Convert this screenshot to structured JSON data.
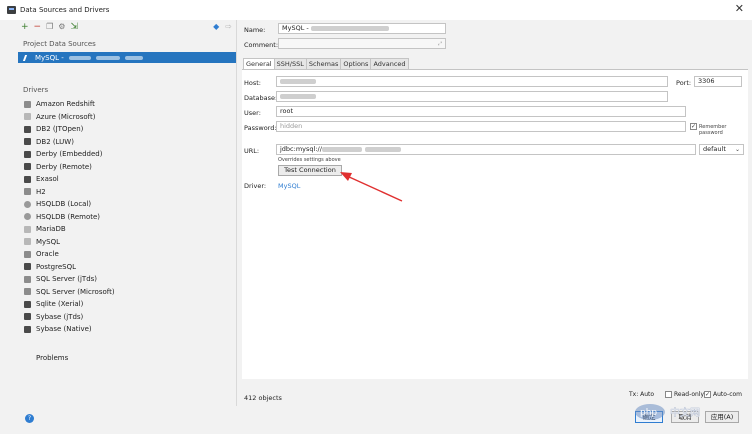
{
  "window": {
    "title": "Data Sources and Drivers",
    "close_glyph": "✕"
  },
  "left": {
    "project_label": "Project Data Sources",
    "selected_source": "MySQL - ",
    "drivers_label": "Drivers",
    "drivers": [
      "Amazon Redshift",
      "Azure (Microsoft)",
      "DB2 (JTOpen)",
      "DB2 (LUW)",
      "Derby (Embedded)",
      "Derby (Remote)",
      "Exasol",
      "H2",
      "HSQLDB (Local)",
      "HSQLDB (Remote)",
      "MariaDB",
      "MySQL",
      "Oracle",
      "PostgreSQL",
      "SQL Server (jTds)",
      "SQL Server (Microsoft)",
      "Sqlite (Xerial)",
      "Sybase (jTds)",
      "Sybase (Native)"
    ],
    "problems_label": "Problems"
  },
  "form": {
    "name_label": "Name:",
    "name_value": "MySQL - ",
    "comment_label": "Comment:",
    "tabs": [
      "General",
      "SSH/SSL",
      "Schemas",
      "Options",
      "Advanced"
    ],
    "host_label": "Host:",
    "port_label": "Port:",
    "port_value": "3306",
    "database_label": "Database:",
    "user_label": "User:",
    "user_value": "root",
    "password_label": "Password:",
    "password_value": "hidden",
    "remember_label": "Remember password",
    "url_label": "URL:",
    "url_value": "jdbc:mysql://",
    "url_mode": "default",
    "overrides_note": "Overrides settings above",
    "test_button": "Test Connection",
    "driver_label": "Driver:",
    "driver_value": "MySQL"
  },
  "footer": {
    "objects_count": "412 objects",
    "tx_label": "Tx: Auto",
    "readonly_label": "Read-only",
    "autocommit_label": "Auto-com",
    "ok_button": "确定",
    "cancel_button": "取消",
    "apply_button": "应用(A)",
    "help_glyph": "?"
  },
  "watermark": {
    "logo_text": "php",
    "site_text": "中文网"
  },
  "colors": {
    "accent": "#2675bf",
    "arrow": "#e03030",
    "link": "#2f7dd1"
  }
}
